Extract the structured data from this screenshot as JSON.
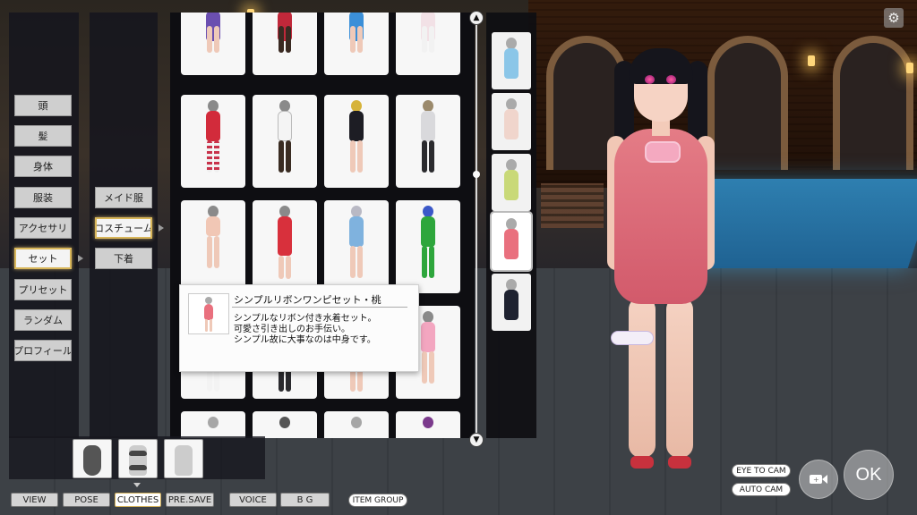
{
  "left_menu": {
    "items": [
      {
        "label": "頭"
      },
      {
        "label": "髪"
      },
      {
        "label": "身体"
      },
      {
        "label": "服装"
      },
      {
        "label": "アクセサリ"
      },
      {
        "label": "セット",
        "selected": true
      },
      {
        "label": "プリセット"
      },
      {
        "label": "ランダム"
      },
      {
        "label": "プロフィール"
      }
    ]
  },
  "sub_menu": {
    "items": [
      {
        "label": "メイド服"
      },
      {
        "label": "コスチューム",
        "selected": true
      },
      {
        "label": "下着"
      }
    ]
  },
  "tooltip": {
    "title": "シンプルリボンワンピセット・桃",
    "desc_line1": "シンプルなリボン付き水着セット。",
    "desc_line2": "可愛さ引き出しのお手伝い。",
    "desc_line3": "シンプル故に大事なのは中身です。"
  },
  "bottom_tabs": [
    {
      "label": "VIEW"
    },
    {
      "label": "POSE"
    },
    {
      "label": "CLOTHES",
      "selected": true
    },
    {
      "label": "PRE.SAVE"
    },
    {
      "label": "VOICE"
    },
    {
      "label": "B G"
    }
  ],
  "item_group_label": "ITEM GROUP",
  "camera": {
    "eye_to_cam": "EYE TO CAM",
    "auto_cam": "AUTO CAM"
  },
  "ok_label": "OK",
  "colors": {
    "accent_gold": "#d8b65a",
    "panel_dark": "#16161e",
    "button_gray": "#cfcfcf",
    "swimsuit_pink": "#e47c86"
  },
  "icons": {
    "gear": "gear-icon",
    "camera": "video-camera-icon",
    "scroll_up": "arrow-up-icon",
    "scroll_down": "arrow-down-icon"
  }
}
